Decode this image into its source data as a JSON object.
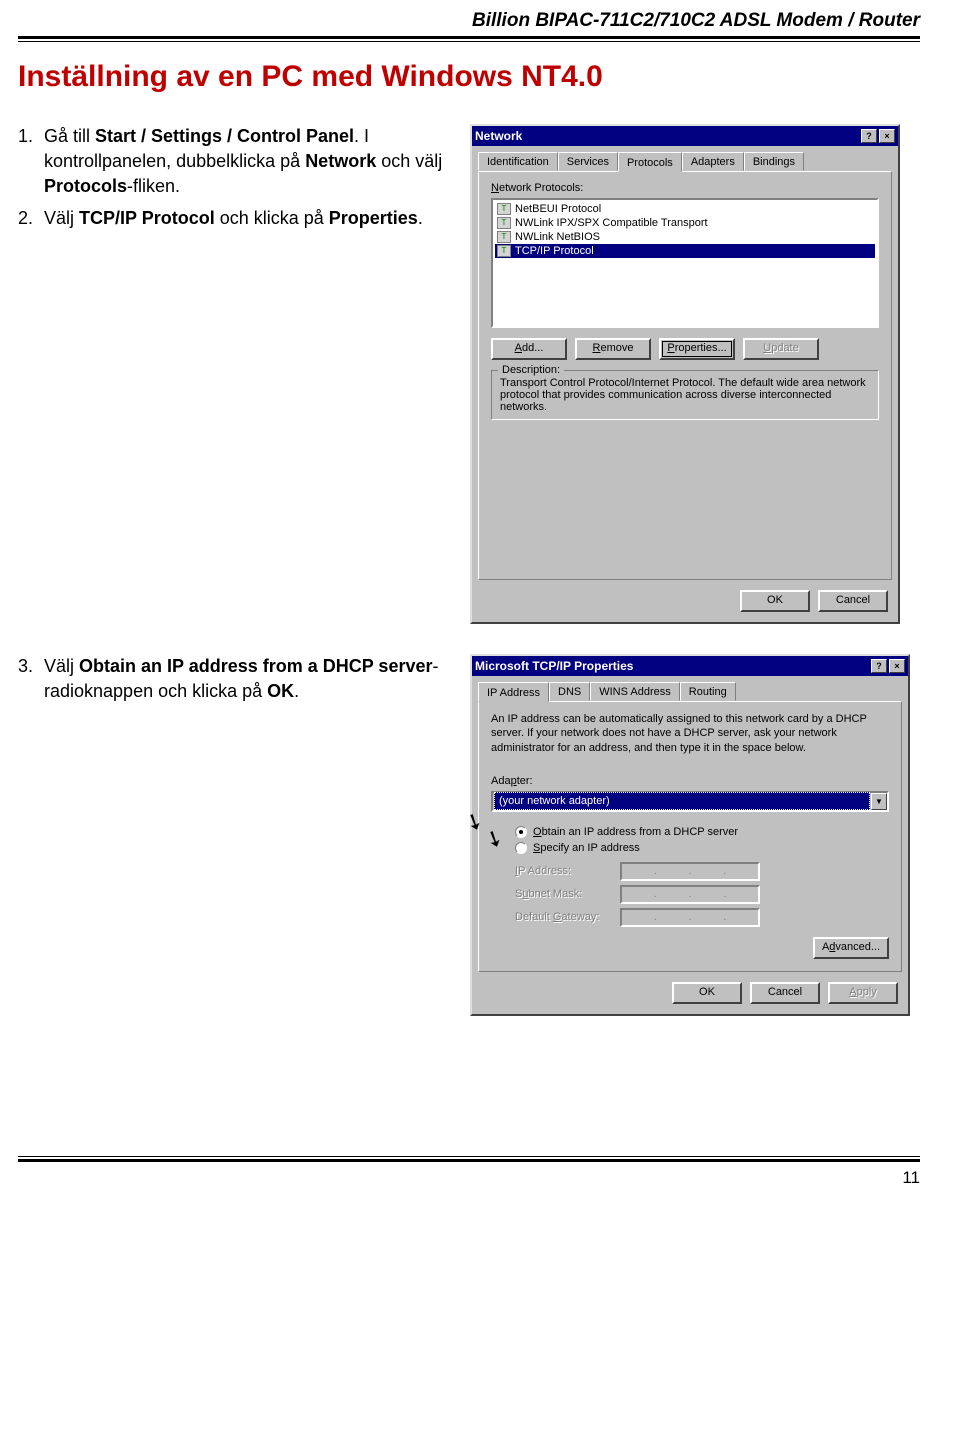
{
  "header": {
    "product": "Billion BIPAC-711C2/710C2 ADSL Modem / Router"
  },
  "title": "Inställning av en PC med Windows NT4.0",
  "steps": {
    "s1_num": "1.",
    "s1_a": "Gå till ",
    "s1_b": "Start / Settings / Control Panel",
    "s1_c": ". I kontrollpanelen, dubbelklicka på ",
    "s1_d": "Network",
    "s1_e": " och välj ",
    "s1_f": "Protocols",
    "s1_g": "-fliken.",
    "s2_num": "2.",
    "s2_a": "Välj ",
    "s2_b": "TCP/IP Protocol",
    "s2_c": " och klicka på ",
    "s2_d": "Properties",
    "s2_e": ".",
    "s3_num": "3.",
    "s3_a": "Välj ",
    "s3_b": "Obtain an IP address from a DHCP server",
    "s3_c": "-radioknappen och klicka på ",
    "s3_d": "OK",
    "s3_e": "."
  },
  "dlg1": {
    "title": "Network",
    "help": "?",
    "close": "×",
    "tabs": {
      "t1": "Identification",
      "t2": "Services",
      "t3": "Protocols",
      "t4": "Adapters",
      "t5": "Bindings"
    },
    "listlabel_pre": "N",
    "listlabel_post": "etwork Protocols:",
    "items": {
      "i1": "NetBEUI Protocol",
      "i2": "NWLink IPX/SPX Compatible Transport",
      "i3": "NWLink NetBIOS",
      "i4": "TCP/IP Protocol"
    },
    "btn_add": "Add...",
    "btn_remove": "Remove",
    "btn_props": "Properties...",
    "btn_update": "Update",
    "desc_legend": "Description:",
    "desc_text": "Transport Control Protocol/Internet Protocol. The default wide area network protocol that provides communication across diverse interconnected networks.",
    "ok": "OK",
    "cancel": "Cancel"
  },
  "dlg2": {
    "title": "Microsoft TCP/IP Properties",
    "help": "?",
    "close": "×",
    "tabs": {
      "t1": "IP Address",
      "t2": "DNS",
      "t3": "WINS Address",
      "t4": "Routing"
    },
    "info": "An IP address can be automatically assigned to this network card by a DHCP server. If your network does not have a DHCP server, ask your network administrator for an address, and then type it in the space below.",
    "adapter_pre": "Ada",
    "adapter_u": "p",
    "adapter_post": "ter:",
    "adapter_val": "(your network adapter)",
    "combo_arrow": "▼",
    "r1_pre": "O",
    "r1_post": "btain an IP address from a DHCP server",
    "r2_pre": "S",
    "r2_post": "pecify an IP address",
    "ip_pre": "I",
    "ip_post": "P Address:",
    "sm_label": "Subnet Mask:",
    "gw_label": "Default Gateway:",
    "dot": ".",
    "adv": "Advanced...",
    "ok": "OK",
    "cancel": "Cancel",
    "apply": "Apply"
  },
  "pagenum": "11"
}
